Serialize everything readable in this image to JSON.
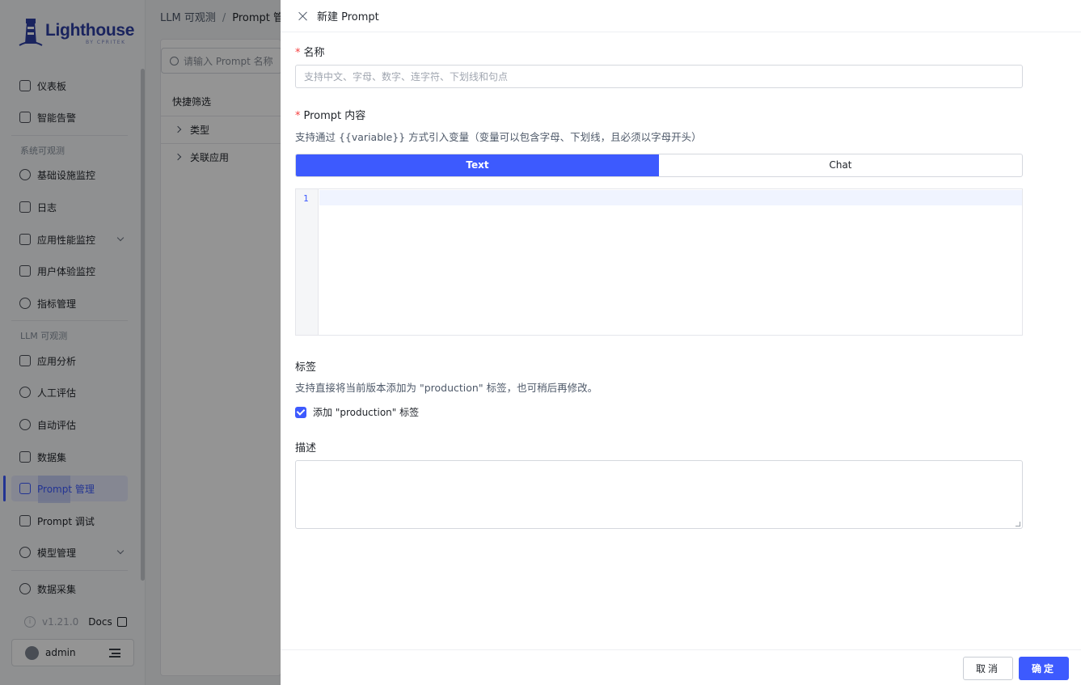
{
  "brand": {
    "name": "Lighthouse",
    "sub": "BY CPRITEK"
  },
  "sidebar": {
    "items": [
      {
        "label": "仪表板"
      },
      {
        "label": "智能告警"
      },
      {
        "label": "基础设施监控"
      },
      {
        "label": "日志"
      },
      {
        "label": "应用性能监控"
      },
      {
        "label": "用户体验监控"
      },
      {
        "label": "指标管理"
      },
      {
        "label": "应用分析"
      },
      {
        "label": "人工评估"
      },
      {
        "label": "自动评估"
      },
      {
        "label": "数据集"
      },
      {
        "label": "Prompt 管理"
      },
      {
        "label": "Prompt 调试"
      },
      {
        "label": "模型管理"
      },
      {
        "label": "数据采集"
      }
    ],
    "groups": {
      "system": "系统可观测",
      "llm": "LLM 可观测"
    },
    "version": "v1.21.0",
    "docs": "Docs",
    "user": "admin"
  },
  "main": {
    "breadcrumb": {
      "parent": "LLM 可观测",
      "current": "Prompt 管理"
    },
    "search_placeholder": "请输入 Prompt 名称",
    "quick_filter": "快捷筛选",
    "filters": [
      "类型",
      "关联应用"
    ]
  },
  "drawer": {
    "title": "新建 Prompt",
    "name_label": "名称",
    "name_placeholder": "支持中文、字母、数字、连字符、下划线和句点",
    "content_label": "Prompt 内容",
    "content_hint": "支持通过 {{variable}} 方式引入变量（变量可以包含字母、下划线，且必须以字母开头）",
    "tabs": [
      "Text",
      "Chat"
    ],
    "line_number": "1",
    "tags_label": "标签",
    "tags_hint": "支持直接将当前版本添加为 \"production\" 标签，也可稍后再修改。",
    "tag_checkbox": "添加 \"production\" 标签",
    "desc_label": "描述",
    "cancel": "取消",
    "confirm": "确定"
  },
  "colors": {
    "primary": "#3d5afe",
    "required": "#f53f3f"
  }
}
